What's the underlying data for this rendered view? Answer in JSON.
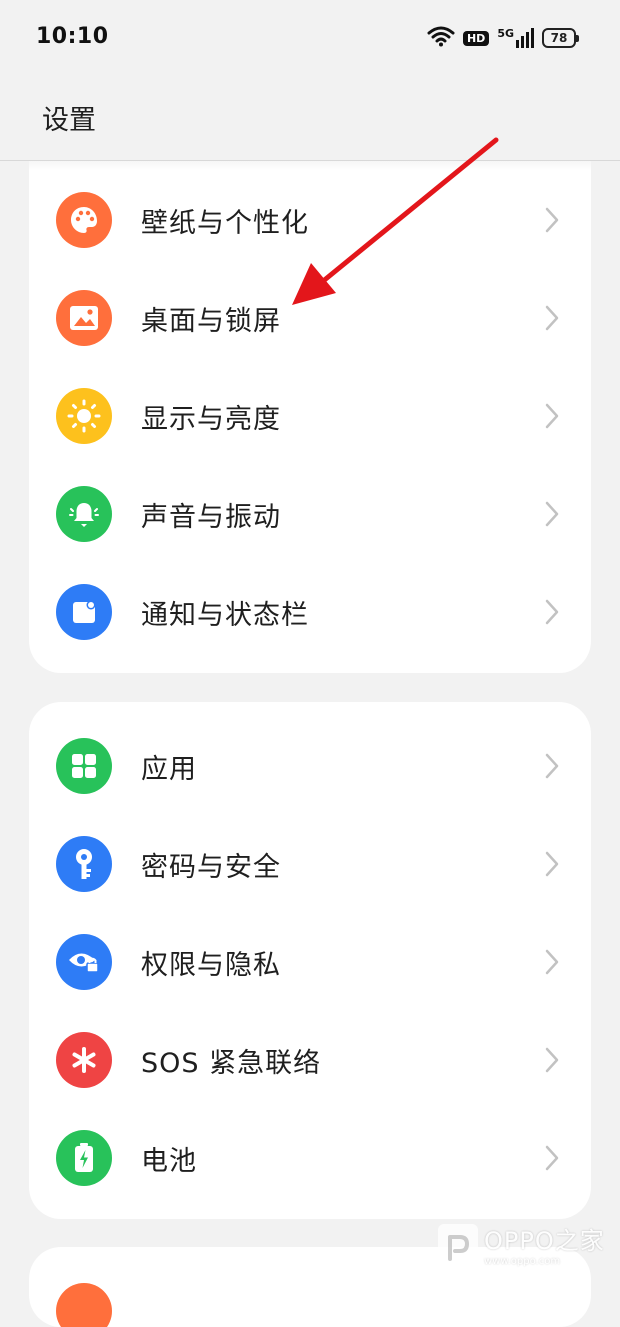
{
  "status_bar": {
    "time": "10:10",
    "hd_label": "HD",
    "network_label": "5G",
    "battery_level": "78",
    "icons": [
      "wifi-icon",
      "hd-icon",
      "signal-5g-icon",
      "battery-icon"
    ]
  },
  "header": {
    "title": "设置"
  },
  "groups": [
    {
      "items": [
        {
          "label": "壁纸与个性化",
          "icon": "palette-icon",
          "color": "#ff6f3c"
        },
        {
          "label": "桌面与锁屏",
          "icon": "picture-icon",
          "color": "#ff6f3c"
        },
        {
          "label": "显示与亮度",
          "icon": "sun-icon",
          "color": "#fdc11d"
        },
        {
          "label": "声音与振动",
          "icon": "bell-icon",
          "color": "#28c25a"
        },
        {
          "label": "通知与状态栏",
          "icon": "notification-icon",
          "color": "#2e7cf6"
        }
      ]
    },
    {
      "items": [
        {
          "label": "应用",
          "icon": "apps-grid-icon",
          "color": "#28c25a"
        },
        {
          "label": "密码与安全",
          "icon": "key-icon",
          "color": "#2e7cf6"
        },
        {
          "label": "权限与隐私",
          "icon": "privacy-eye-icon",
          "color": "#2e7cf6"
        },
        {
          "label": "SOS 紧急联络",
          "icon": "sos-asterisk-icon",
          "color": "#ef4444"
        },
        {
          "label": "电池",
          "icon": "battery-charging-icon",
          "color": "#28c25a"
        }
      ]
    },
    {
      "items": [
        {
          "label": "",
          "icon": "partial-icon",
          "color": "#ff6f3c"
        }
      ]
    }
  ],
  "watermark": {
    "brand": "OPPO之家",
    "url": "www.oppo.com"
  },
  "colors": {
    "background": "#f2f2f2",
    "card": "#ffffff",
    "annotation_arrow": "#e3161b",
    "chevron": "#c2c2c2"
  }
}
